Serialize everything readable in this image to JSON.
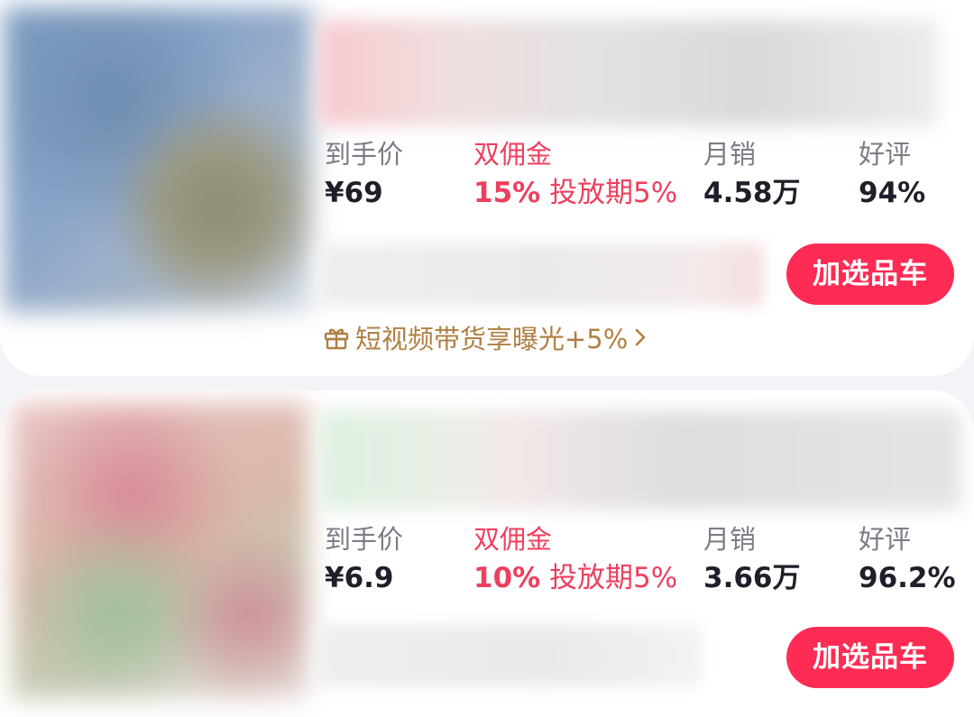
{
  "colors": {
    "accent_red": "#fe2c55",
    "commission_red": "#ee3f5e",
    "promo_gold": "#b07f43",
    "label_gray": "#7b7d86",
    "value_dark": "#1d1f29"
  },
  "products": [
    {
      "labels": {
        "price": "到手价",
        "commission": "双佣金",
        "monthly_sales": "月销",
        "rating": "好评"
      },
      "price_value": "¥69",
      "commission_rate": "15%",
      "commission_period": "投放期5%",
      "monthly_sales_value": "4.58万",
      "rating_value": "94%",
      "add_button_label": "加选品车",
      "promo_text": "短视频带货享曝光+5%",
      "promo_icon": "gift-icon",
      "promo_arrow_icon": "chevron-right-icon"
    },
    {
      "labels": {
        "price": "到手价",
        "commission": "双佣金",
        "monthly_sales": "月销",
        "rating": "好评"
      },
      "price_value": "¥6.9",
      "commission_rate": "10%",
      "commission_period": "投放期5%",
      "monthly_sales_value": "3.66万",
      "rating_value": "96.2%",
      "add_button_label": "加选品车"
    }
  ]
}
